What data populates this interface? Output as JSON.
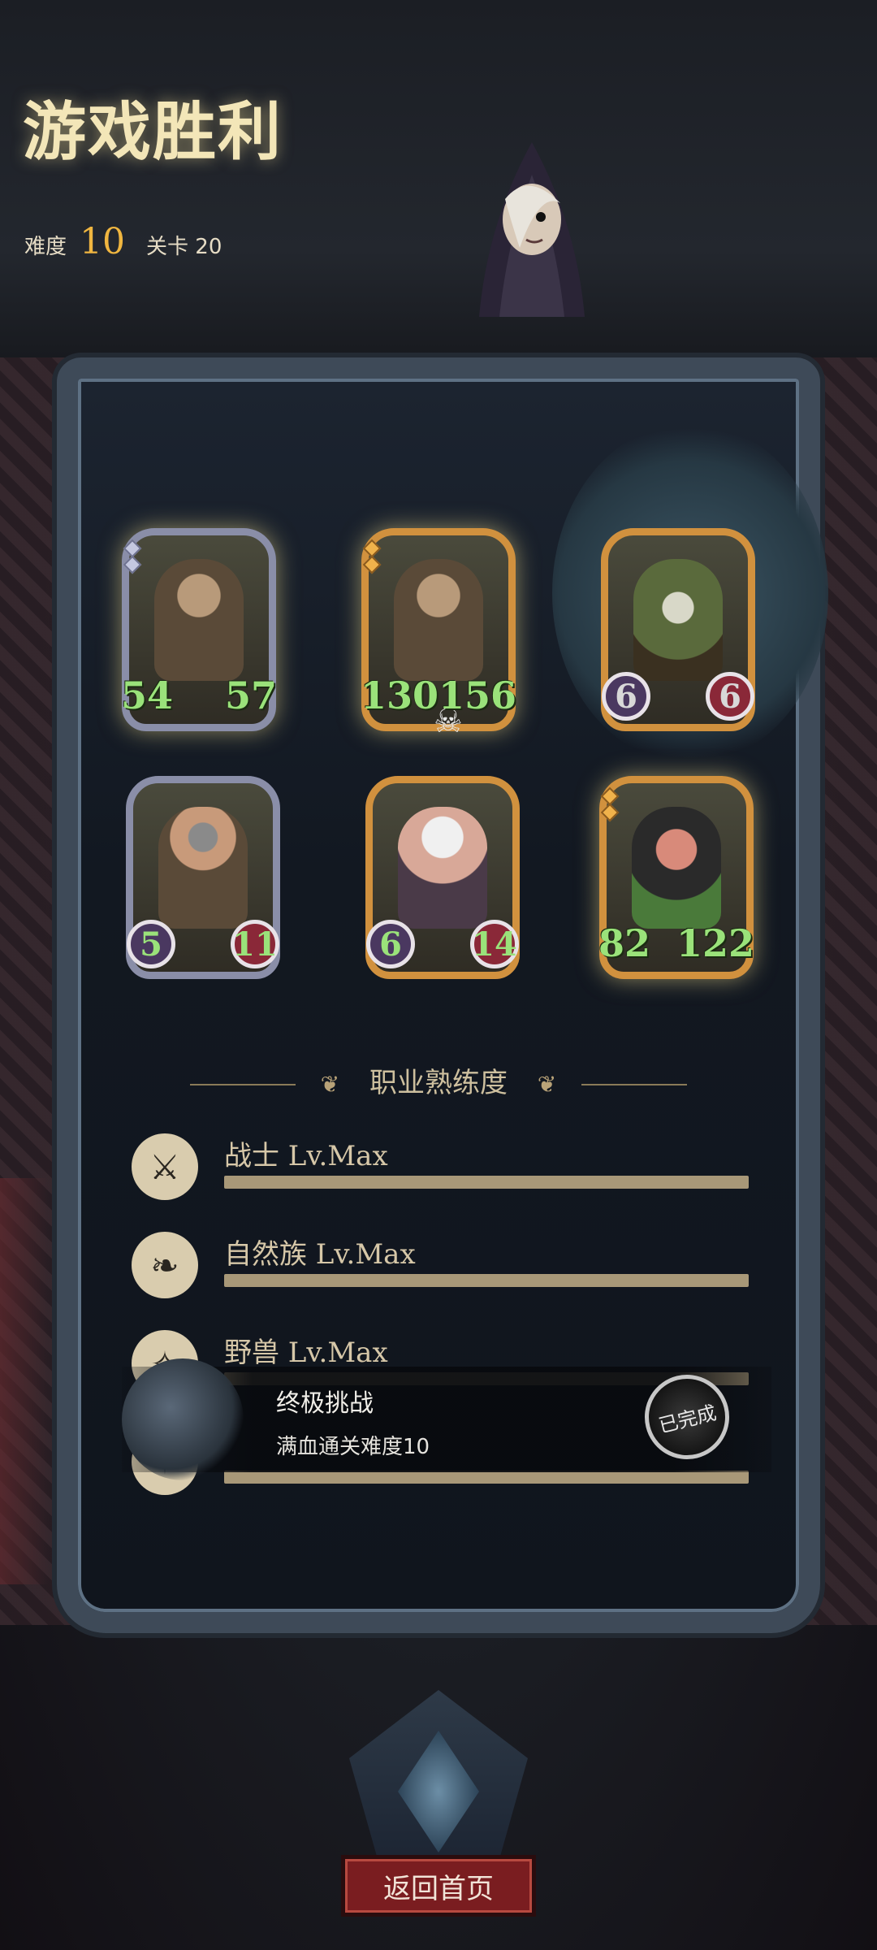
{
  "header": {
    "title": "游戏胜利",
    "difficulty_label": "难度",
    "difficulty_value": "10",
    "stage_label": "关卡 20"
  },
  "cards": [
    {
      "atk": "54",
      "hp": "57",
      "frame": "silver",
      "pips": 2,
      "portrait": "bald-brute"
    },
    {
      "atk": "130",
      "hp": "156",
      "frame": "gold",
      "pips": 2,
      "portrait": "bald-brute",
      "skull": true
    },
    {
      "atk": "6",
      "hp": "6",
      "frame": "gold",
      "pips": 0,
      "portrait": "moth-creature"
    },
    {
      "atk": "5",
      "hp": "11",
      "frame": "silver",
      "pips": 0,
      "portrait": "helmeted-dwarf"
    },
    {
      "atk": "6",
      "hp": "14",
      "frame": "gold",
      "pips": 0,
      "portrait": "monocle-elder"
    },
    {
      "atk": "82",
      "hp": "122",
      "frame": "gold",
      "pips": 2,
      "portrait": "witch"
    }
  ],
  "mastery": {
    "title": "职业熟练度",
    "rows": [
      {
        "label": "战士 Lv.Max",
        "icon": "sword-icon",
        "progress": 1.0
      },
      {
        "label": "自然族 Lv.Max",
        "icon": "leaf-icon",
        "progress": 1.0
      },
      {
        "label": "野兽 Lv.Max",
        "icon": "claw-icon",
        "progress": 1.0
      }
    ]
  },
  "achievement": {
    "title": "终极挑战",
    "description": "满血通关难度10",
    "status": "已完成"
  },
  "footer": {
    "home_button": "返回首页"
  },
  "colors": {
    "title": "#f3e6b8",
    "difficulty": "#f0b640",
    "stat_green": "#9ae27a",
    "button_red": "#7a1d20"
  }
}
